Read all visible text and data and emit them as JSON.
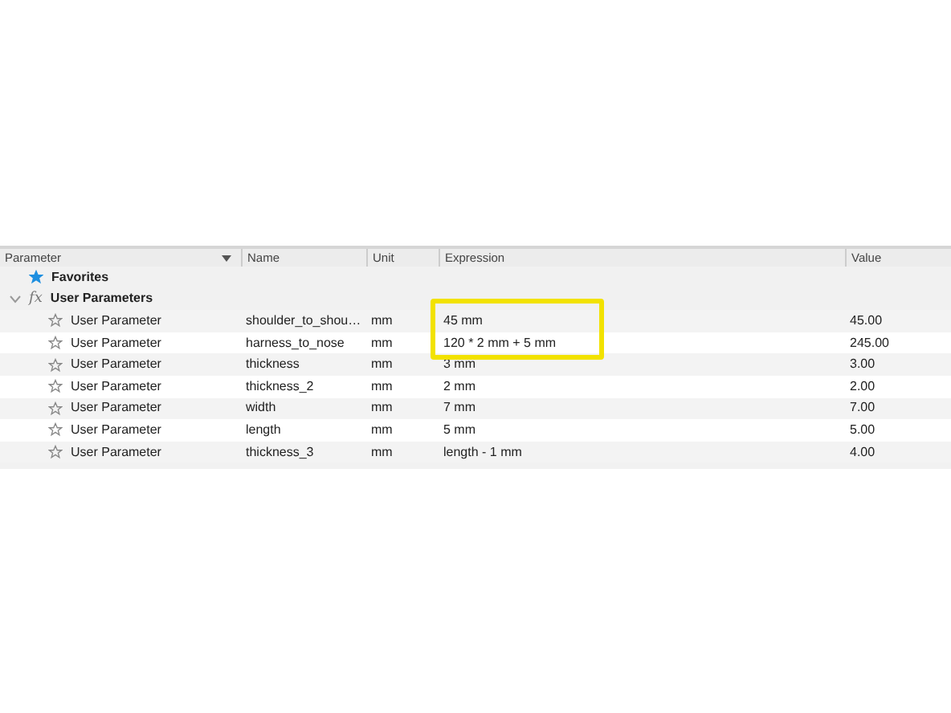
{
  "table": {
    "columns": [
      "Parameter",
      "Name",
      "Unit",
      "Expression",
      "Value"
    ],
    "favorites": {
      "label": "Favorites"
    },
    "group": {
      "icon_text": "fx",
      "label": "User Parameters",
      "expanded": true,
      "rows": [
        {
          "parameter": "User Parameter",
          "name": "shoulder_to_shou…",
          "unit": "mm",
          "expression": "45 mm",
          "value": "45.00",
          "favorite": false,
          "highlighted": true
        },
        {
          "parameter": "User Parameter",
          "name": "harness_to_nose",
          "unit": "mm",
          "expression": "120 * 2 mm + 5 mm",
          "value": "245.00",
          "favorite": false,
          "highlighted": true
        },
        {
          "parameter": "User Parameter",
          "name": "thickness",
          "unit": "mm",
          "expression": "3 mm",
          "value": "3.00",
          "favorite": false,
          "highlighted": false
        },
        {
          "parameter": "User Parameter",
          "name": "thickness_2",
          "unit": "mm",
          "expression": "2 mm",
          "value": "2.00",
          "favorite": false,
          "highlighted": false
        },
        {
          "parameter": "User Parameter",
          "name": "width",
          "unit": "mm",
          "expression": "7 mm",
          "value": "7.00",
          "favorite": false,
          "highlighted": false
        },
        {
          "parameter": "User Parameter",
          "name": "length",
          "unit": "mm",
          "expression": "5 mm",
          "value": "5.00",
          "favorite": false,
          "highlighted": false
        },
        {
          "parameter": "User Parameter",
          "name": "thickness_3",
          "unit": "mm",
          "expression": "length - 1 mm",
          "value": "4.00",
          "favorite": false,
          "highlighted": false
        }
      ]
    }
  }
}
